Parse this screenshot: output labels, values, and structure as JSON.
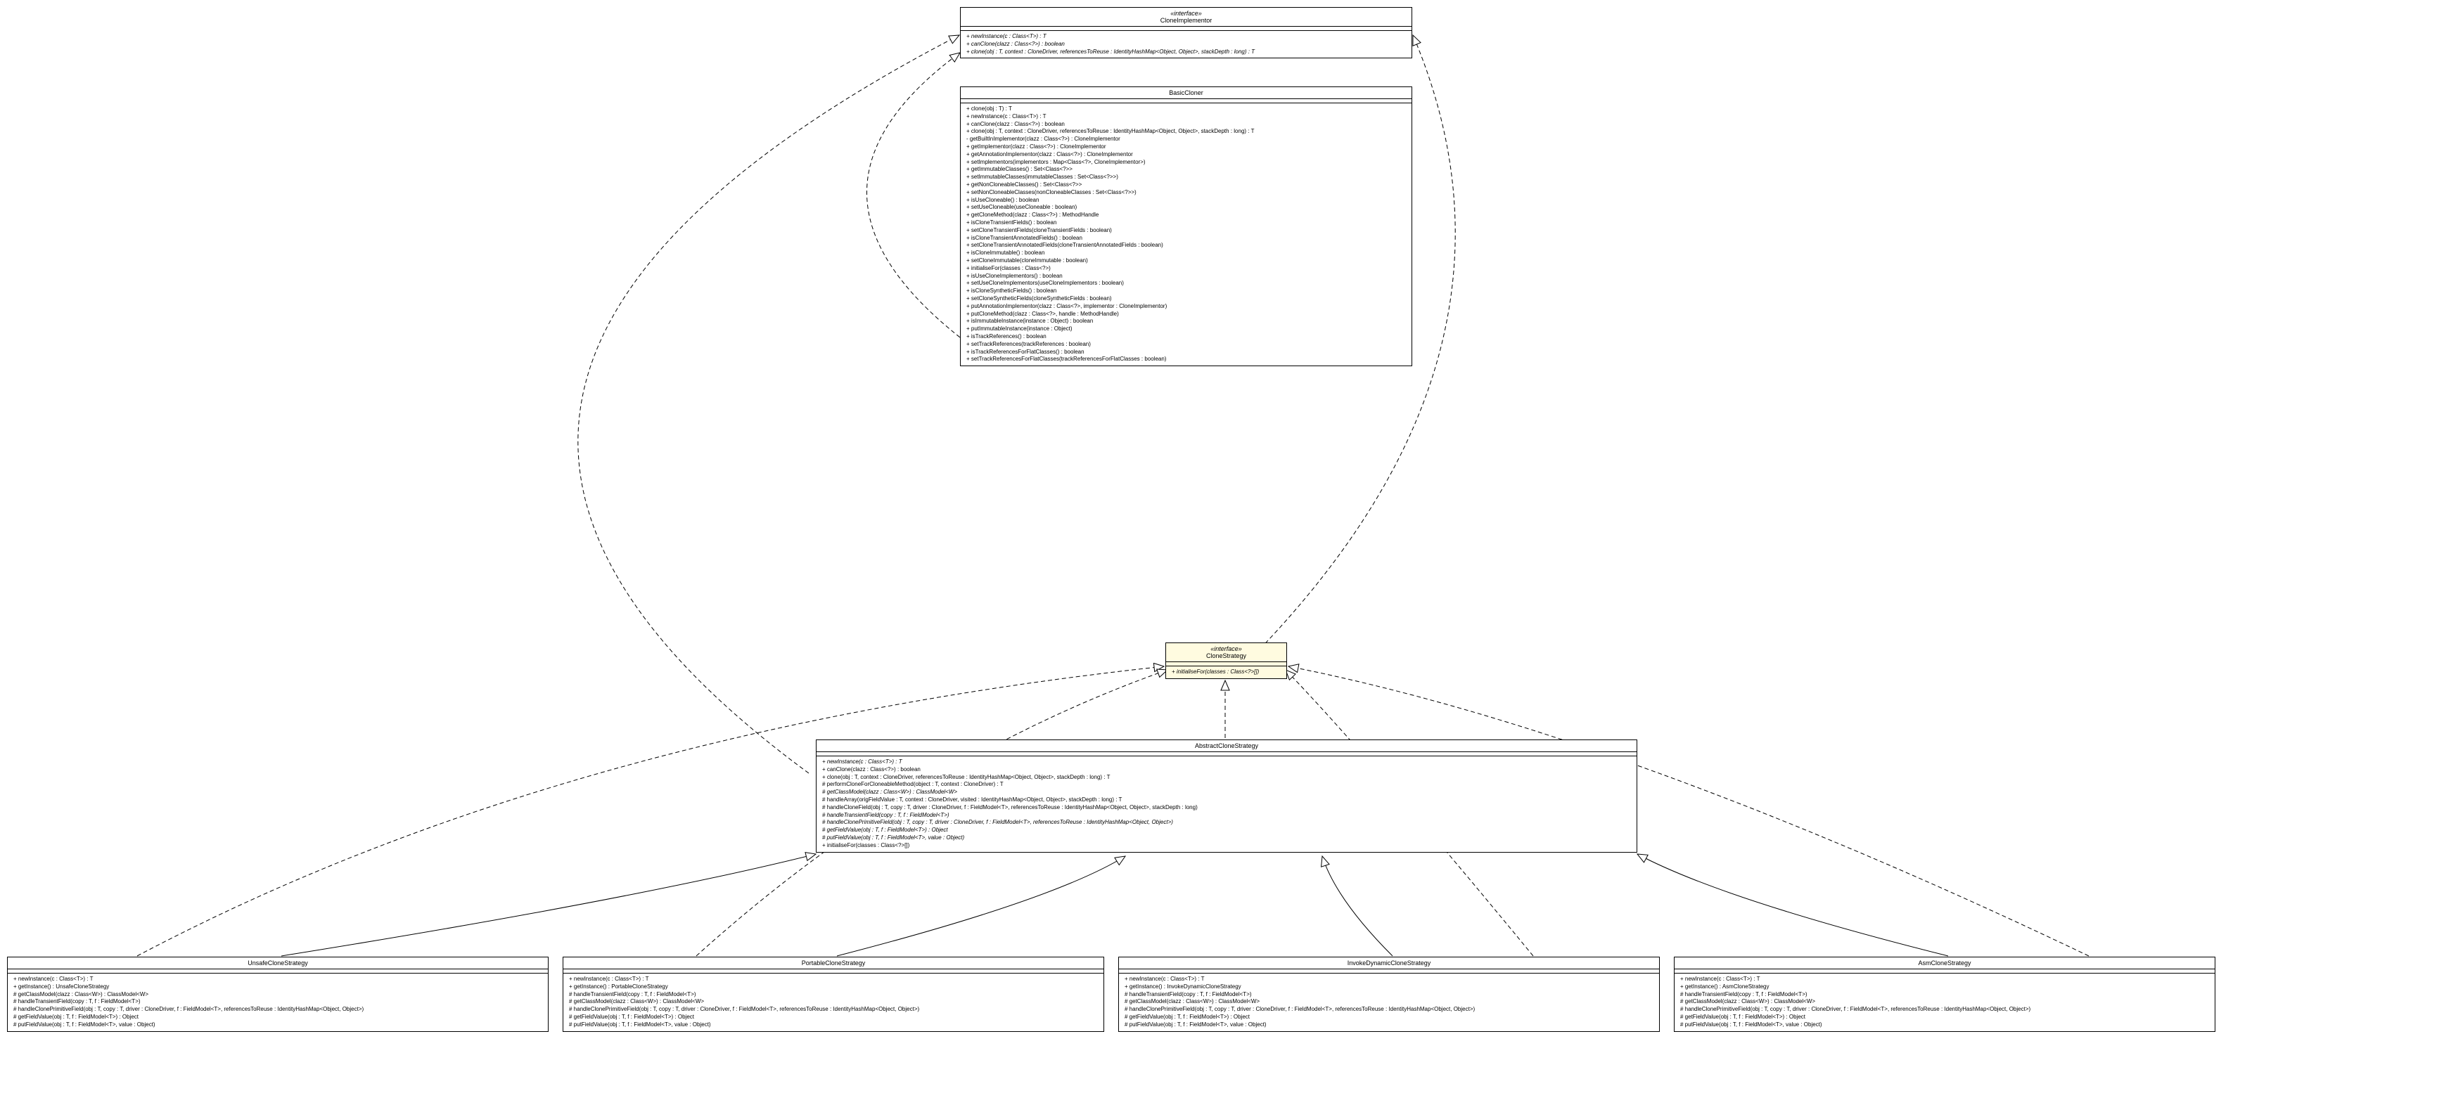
{
  "classes": {
    "cloneImplementor": {
      "stereotype": "«interface»",
      "name": "CloneImplementor",
      "ops": [
        {
          "t": "+ newInstance(c : Class<T>) : T",
          "i": true
        },
        {
          "t": "+ canClone(clazz : Class<?>) : boolean",
          "i": true
        },
        {
          "t": "+ clone(obj : T, context : CloneDriver, referencesToReuse : IdentityHashMap<Object, Object>, stackDepth : long) : T",
          "i": true
        }
      ]
    },
    "basicCloner": {
      "name": "BasicCloner",
      "ops": [
        {
          "t": "+ clone(obj : T) : T"
        },
        {
          "t": "+ newInstance(c : Class<T>) : T"
        },
        {
          "t": "+ canClone(clazz : Class<?>) : boolean"
        },
        {
          "t": "+ clone(obj : T, context : CloneDriver, referencesToReuse : IdentityHashMap<Object, Object>, stackDepth : long) : T"
        },
        {
          "t": "- getBuiltInImplementor(clazz : Class<?>) : CloneImplementor"
        },
        {
          "t": "+ getImplementor(clazz : Class<?>) : CloneImplementor"
        },
        {
          "t": "+ getAnnotationImplementor(clazz : Class<?>) : CloneImplementor"
        },
        {
          "t": "+ setImplementors(implementors : Map<Class<?>, CloneImplementor>)"
        },
        {
          "t": "+ getImmutableClasses() : Set<Class<?>>"
        },
        {
          "t": "+ setImmutableClasses(immutableClasses : Set<Class<?>>)"
        },
        {
          "t": "+ getNonCloneableClasses() : Set<Class<?>>"
        },
        {
          "t": "+ setNonCloneableClasses(nonCloneableClasses : Set<Class<?>>)"
        },
        {
          "t": "+ isUseCloneable() : boolean"
        },
        {
          "t": "+ setUseCloneable(useCloneable : boolean)"
        },
        {
          "t": "+ getCloneMethod(clazz : Class<?>) : MethodHandle"
        },
        {
          "t": "+ isCloneTransientFields() : boolean"
        },
        {
          "t": "+ setCloneTransientFields(cloneTransientFields : boolean)"
        },
        {
          "t": "+ isCloneTransientAnnotatedFields() : boolean"
        },
        {
          "t": "+ setCloneTransientAnnotatedFields(cloneTransientAnnotatedFields : boolean)"
        },
        {
          "t": "+ isCloneImmutable() : boolean"
        },
        {
          "t": "+ setCloneImmutable(cloneImmutable : boolean)"
        },
        {
          "t": "+ initialiseFor(classes : Class<?>)"
        },
        {
          "t": "+ isUseCloneImplementors() : boolean"
        },
        {
          "t": "+ setUseCloneImplementors(useCloneImplementors : boolean)"
        },
        {
          "t": "+ isCloneSyntheticFields() : boolean"
        },
        {
          "t": "+ setCloneSyntheticFields(cloneSyntheticFields : boolean)"
        },
        {
          "t": "+ putAnnotationImplementor(clazz : Class<?>, implementor : CloneImplementor)"
        },
        {
          "t": "+ putCloneMethod(clazz : Class<?>, handle : MethodHandle)"
        },
        {
          "t": "+ isImmutableInstance(instance : Object) : boolean"
        },
        {
          "t": "+ putImmutableInstance(instance : Object)"
        },
        {
          "t": "+ isTrackReferences() : boolean"
        },
        {
          "t": "+ setTrackReferences(trackReferences : boolean)"
        },
        {
          "t": "+ isTrackReferencesForFlatClasses() : boolean"
        },
        {
          "t": "+ setTrackReferencesForFlatClasses(trackReferencesForFlatClasses : boolean)"
        }
      ]
    },
    "cloneStrategy": {
      "stereotype": "«interface»",
      "name": "CloneStrategy",
      "ops": [
        {
          "t": "+ initialiseFor(classes : Class<?>[])",
          "i": true
        }
      ]
    },
    "abstractCloneStrategy": {
      "name": "AbstractCloneStrategy",
      "ops": [
        {
          "t": "+ newInstance(c : Class<T>) : T",
          "i": true
        },
        {
          "t": "+ canClone(clazz : Class<?>) : boolean"
        },
        {
          "t": "+ clone(obj : T, context : CloneDriver, referencesToReuse : IdentityHashMap<Object, Object>, stackDepth : long) : T"
        },
        {
          "t": "# performCloneForCloneableMethod(object : T, context : CloneDriver) : T"
        },
        {
          "t": "# getClassModel(clazz : Class<W>) : ClassModel<W>",
          "i": true
        },
        {
          "t": "# handleArray(origFieldValue : T, context : CloneDriver, visited : IdentityHashMap<Object, Object>, stackDepth : long) : T"
        },
        {
          "t": "# handleCloneField(obj : T, copy : T, driver : CloneDriver, f : FieldModel<T>, referencesToReuse : IdentityHashMap<Object, Object>, stackDepth : long)"
        },
        {
          "t": "# handleTransientField(copy : T, f : FieldModel<T>)",
          "i": true
        },
        {
          "t": "# handleClonePrimitiveField(obj : T, copy : T, driver : CloneDriver, f : FieldModel<T>, referencesToReuse : IdentityHashMap<Object, Object>)",
          "i": true
        },
        {
          "t": "# getFieldValue(obj : T, f : FieldModel<T>) : Object",
          "i": true
        },
        {
          "t": "# putFieldValue(obj : T, f : FieldModel<T>, value : Object)",
          "i": true
        },
        {
          "t": "+ initialiseFor(classes : Class<?>[])"
        }
      ]
    },
    "unsafeCloneStrategy": {
      "name": "UnsafeCloneStrategy",
      "ops": [
        {
          "t": "+ newInstance(c : Class<T>) : T"
        },
        {
          "t": "+ getInstance() : UnsafeCloneStrategy"
        },
        {
          "t": "# getClassModel(clazz : Class<W>) : ClassModel<W>"
        },
        {
          "t": "# handleTransientField(copy : T, f : FieldModel<T>)"
        },
        {
          "t": "# handleClonePrimitiveField(obj : T, copy : T, driver : CloneDriver, f : FieldModel<T>, referencesToReuse : IdentityHashMap<Object, Object>)"
        },
        {
          "t": "# getFieldValue(obj : T, f : FieldModel<T>) : Object"
        },
        {
          "t": "# putFieldValue(obj : T, f : FieldModel<T>, value : Object)"
        }
      ]
    },
    "portableCloneStrategy": {
      "name": "PortableCloneStrategy",
      "ops": [
        {
          "t": "+ newInstance(c : Class<T>) : T"
        },
        {
          "t": "+ getInstance() : PortableCloneStrategy"
        },
        {
          "t": "# handleTransientField(copy : T, f : FieldModel<T>)"
        },
        {
          "t": "# getClassModel(clazz : Class<W>) : ClassModel<W>"
        },
        {
          "t": "# handleClonePrimitiveField(obj : T, copy : T, driver : CloneDriver, f : FieldModel<T>, referencesToReuse : IdentityHashMap<Object, Object>)"
        },
        {
          "t": "# getFieldValue(obj : T, f : FieldModel<T>) : Object"
        },
        {
          "t": "# putFieldValue(obj : T, f : FieldModel<T>, value : Object)"
        }
      ]
    },
    "invokeDynamicCloneStrategy": {
      "name": "InvokeDynamicCloneStrategy",
      "ops": [
        {
          "t": "+ newInstance(c : Class<T>) : T"
        },
        {
          "t": "+ getInstance() : InvokeDynamicCloneStrategy"
        },
        {
          "t": "# handleTransientField(copy : T, f : FieldModel<T>)"
        },
        {
          "t": "# getClassModel(clazz : Class<W>) : ClassModel<W>"
        },
        {
          "t": "# handleClonePrimitiveField(obj : T, copy : T, driver : CloneDriver, f : FieldModel<T>, referencesToReuse : IdentityHashMap<Object, Object>)"
        },
        {
          "t": "# getFieldValue(obj : T, f : FieldModel<T>) : Object"
        },
        {
          "t": "# putFieldValue(obj : T, f : FieldModel<T>, value : Object)"
        }
      ]
    },
    "asmCloneStrategy": {
      "name": "AsmCloneStrategy",
      "ops": [
        {
          "t": "+ newInstance(c : Class<T>) : T"
        },
        {
          "t": "+ getInstance() : AsmCloneStrategy"
        },
        {
          "t": "# handleTransientField(copy : T, f : FieldModel<T>)"
        },
        {
          "t": "# getClassModel(clazz : Class<W>) : ClassModel<W>"
        },
        {
          "t": "# handleClonePrimitiveField(obj : T, copy : T, driver : CloneDriver, f : FieldModel<T>, referencesToReuse : IdentityHashMap<Object, Object>)"
        },
        {
          "t": "# getFieldValue(obj : T, f : FieldModel<T>) : Object"
        },
        {
          "t": "# putFieldValue(obj : T, f : FieldModel<T>, value : Object)"
        }
      ]
    }
  }
}
